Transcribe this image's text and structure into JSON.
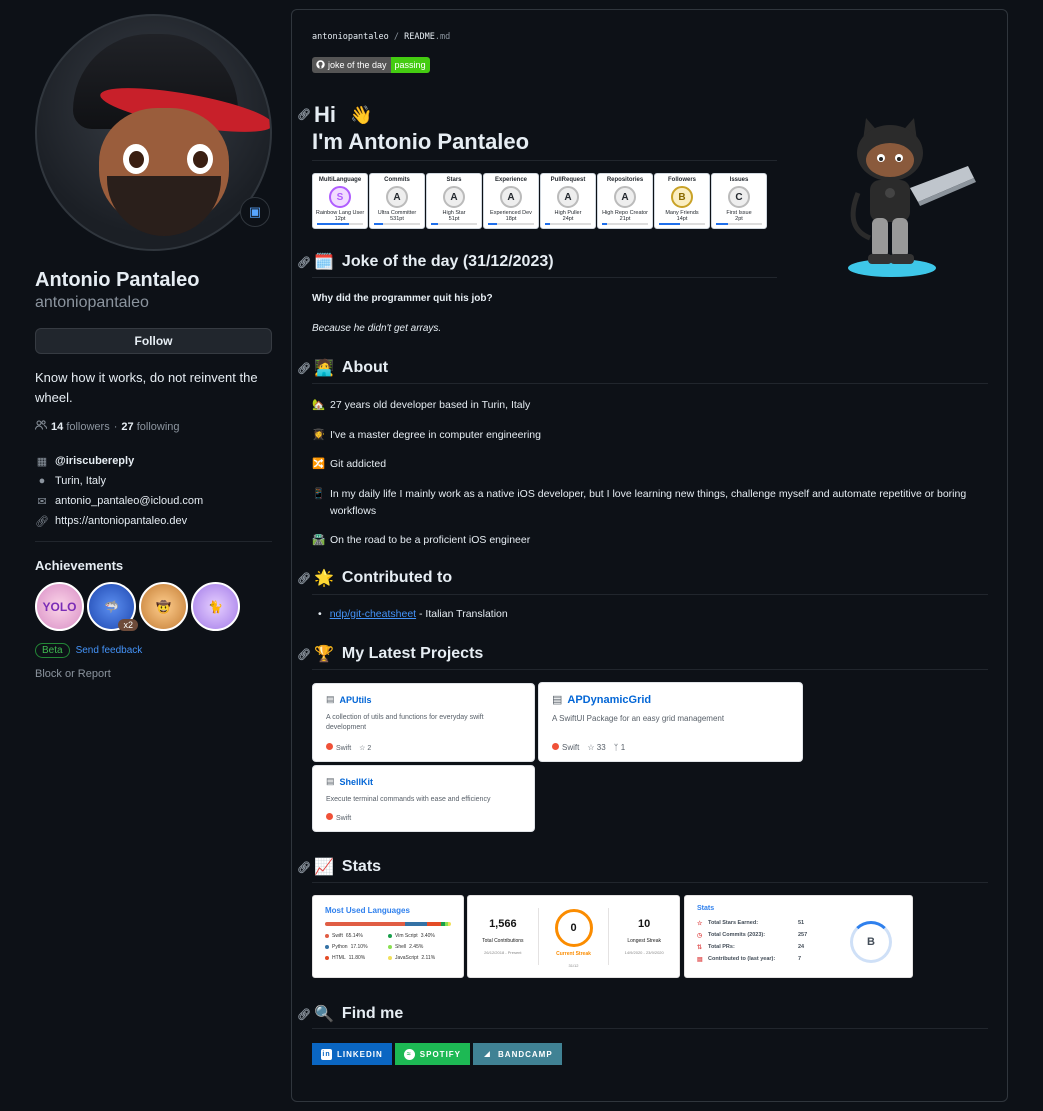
{
  "profile": {
    "fullname": "Antonio Pantaleo",
    "username": "antoniopantaleo",
    "follow_label": "Follow",
    "bio": "Know how it works, do not reinvent the wheel.",
    "followers_count": "14",
    "followers_label": "followers",
    "separator": "·",
    "following_count": "27",
    "following_label": "following",
    "org": "@iriscubereply",
    "location": "Turin, Italy",
    "email": "antonio_pantaleo@icloud.com",
    "website": "https://antoniopantaleo.dev",
    "status_icon": "laptop-icon"
  },
  "achievements": {
    "title": "Achievements",
    "badges": [
      {
        "name": "yolo",
        "text": "YOLO"
      },
      {
        "name": "pull-shark",
        "text": "",
        "count": "x2"
      },
      {
        "name": "starstruck",
        "text": ""
      },
      {
        "name": "quickdraw",
        "text": ""
      }
    ],
    "beta_label": "Beta",
    "feedback_label": "Send feedback"
  },
  "block_label": "Block or Report",
  "readme": {
    "repo": "antoniopantaleo",
    "slash": "/",
    "file": "README",
    "ext": ".md",
    "badge_left": "joke of the day",
    "badge_right": "passing",
    "hi": "Hi",
    "hi_emoji": "👋",
    "intro": "I'm Antonio Pantaleo",
    "trophies": [
      {
        "title": "MultiLanguage",
        "rank": "S",
        "sub": "Rainbow Lang User",
        "pts": "12pt",
        "color": "#b05dff",
        "fill": 0.7
      },
      {
        "title": "Commits",
        "rank": "A",
        "sub": "Ultra Committer",
        "pts": "531pt",
        "color": "#a0a0a0",
        "fill": 0.2
      },
      {
        "title": "Stars",
        "rank": "A",
        "sub": "High Star",
        "pts": "51pt",
        "color": "#a0a0a0",
        "fill": 0.15
      },
      {
        "title": "Experience",
        "rank": "A",
        "sub": "Experienced Dev",
        "pts": "18pt",
        "color": "#a0a0a0",
        "fill": 0.2
      },
      {
        "title": "PullRequest",
        "rank": "A",
        "sub": "High Puller",
        "pts": "24pt",
        "color": "#a0a0a0",
        "fill": 0.1
      },
      {
        "title": "Repositories",
        "rank": "A",
        "sub": "High Repo Creator",
        "pts": "21pt",
        "color": "#a0a0a0",
        "fill": 0.1
      },
      {
        "title": "Followers",
        "rank": "B",
        "sub": "Many Friends",
        "pts": "14pt",
        "color": "#c9a227",
        "fill": 0.45
      },
      {
        "title": "Issues",
        "rank": "C",
        "sub": "First Issue",
        "pts": "2pt",
        "color": "#8c8c8c",
        "fill": 0.25
      }
    ],
    "joke_emoji": "🗓️",
    "joke_title": "Joke of the day (31/12/2023)",
    "joke_question": "Why did the programmer quit his job?",
    "joke_answer": "Because he didn't get arrays.",
    "about_emoji": "🧑‍💻",
    "about_title": "About",
    "about_items": [
      {
        "emoji": "🏡",
        "text": "27 years old developer based in Turin, Italy"
      },
      {
        "emoji": "👩‍🎓",
        "text": "I've a master degree in computer engineering"
      },
      {
        "emoji": "🔀",
        "text": "Git addicted"
      },
      {
        "emoji": "📱",
        "text": "In my daily life I mainly work as a native iOS developer, but I love learning new things, challenge myself and automate repetitive or boring workflows"
      },
      {
        "emoji": "🛣️",
        "text": "On the road to be a proficient iOS engineer"
      }
    ],
    "contrib_emoji": "🌟",
    "contrib_title": "Contributed to",
    "contrib_link": "ndp/git-cheatsheet",
    "contrib_desc": " - Italian Translation",
    "projects_emoji": "🏆",
    "projects_title": "My Latest Projects",
    "projects": [
      {
        "name": "APUtils",
        "desc": "A collection of utils and functions for everyday swift development",
        "lang": "Swift",
        "stars": "2",
        "forks": ""
      },
      {
        "name": "APDynamicGrid",
        "desc": "A SwiftUI Package for an easy grid management",
        "lang": "Swift",
        "stars": "33",
        "forks": "1"
      },
      {
        "name": "ShellKit",
        "desc": "Execute terminal commands with ease and efficiency",
        "lang": "Swift",
        "stars": "",
        "forks": ""
      }
    ],
    "stats_emoji": "📈",
    "stats_title": "Stats",
    "languages": {
      "title": "Most Used Languages",
      "items": [
        {
          "name": "Swift",
          "pct": "65.14%",
          "value": 65.14,
          "color": "#e05d44"
        },
        {
          "name": "Vim Script",
          "pct": "3.40%",
          "value": 3.4,
          "color": "#199f4b"
        },
        {
          "name": "Python",
          "pct": "17.10%",
          "value": 17.1,
          "color": "#3572A5"
        },
        {
          "name": "Shell",
          "pct": "2.45%",
          "value": 2.45,
          "color": "#89e051"
        },
        {
          "name": "HTML",
          "pct": "11.80%",
          "value": 11.8,
          "color": "#e34c26"
        },
        {
          "name": "JavaScript",
          "pct": "2.11%",
          "value": 2.11,
          "color": "#f1e05a"
        }
      ]
    },
    "streak": {
      "total": "1,566",
      "total_label": "Total Contributions",
      "total_range": "26/12/2018 - Present",
      "current": "0",
      "current_label": "Current Streak",
      "current_date": "31/12",
      "longest": "10",
      "longest_label": "Longest Streak",
      "longest_range": "14/9/2020 - 23/9/2020"
    },
    "gh_stats": {
      "title": "Stats",
      "rows": [
        {
          "icon": "star-icon",
          "label": "Total Stars Earned:",
          "value": "51"
        },
        {
          "icon": "clock-icon",
          "label": "Total Commits (2023):",
          "value": "257"
        },
        {
          "icon": "pr-icon",
          "label": "Total PRs:",
          "value": "24"
        },
        {
          "icon": "repo-icon",
          "label": "Contributed to (last year):",
          "value": "7"
        }
      ],
      "grade": "B"
    },
    "find_emoji": "🔍",
    "find_title": "Find me",
    "socials": [
      {
        "label": "LINKEDIN",
        "color": "#0a66c2"
      },
      {
        "label": "SPOTIFY",
        "color": "#1db954"
      },
      {
        "label": "BANDCAMP",
        "color": "#408294"
      }
    ]
  }
}
